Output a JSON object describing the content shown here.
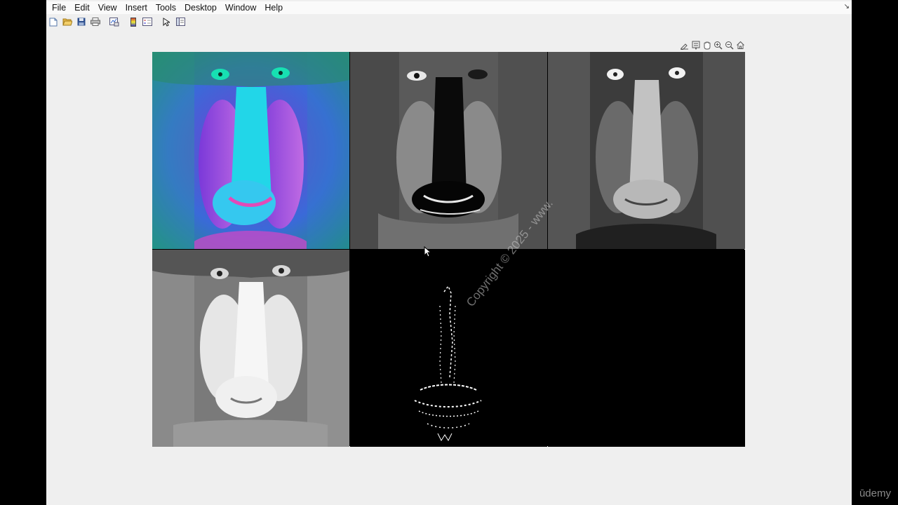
{
  "menu": {
    "items": [
      "File",
      "Edit",
      "View",
      "Insert",
      "Tools",
      "Desktop",
      "Window",
      "Help"
    ]
  },
  "toolbar": {
    "icons": [
      "new-figure-icon",
      "open-file-icon",
      "save-icon",
      "print-icon",
      "link-plot-icon",
      "insert-colorbar-icon",
      "insert-legend-icon",
      "edit-plot-icon",
      "property-inspector-icon"
    ]
  },
  "axes_toolbar": {
    "icons": [
      "brush-icon",
      "datatip-icon",
      "pan-icon",
      "zoom-in-icon",
      "zoom-out-icon",
      "restore-view-icon"
    ]
  },
  "panels": [
    {
      "name": "hsv-mandrill",
      "style": "false-color"
    },
    {
      "name": "hue-channel",
      "style": "grayscale-hue"
    },
    {
      "name": "saturation-channel",
      "style": "grayscale"
    },
    {
      "name": "value-channel",
      "style": "grayscale"
    },
    {
      "name": "binary-mask",
      "style": "binary"
    },
    {
      "name": "empty",
      "style": "black"
    }
  ],
  "watermark": "Copyright © 2025 - www.",
  "branding": "ūdemy"
}
